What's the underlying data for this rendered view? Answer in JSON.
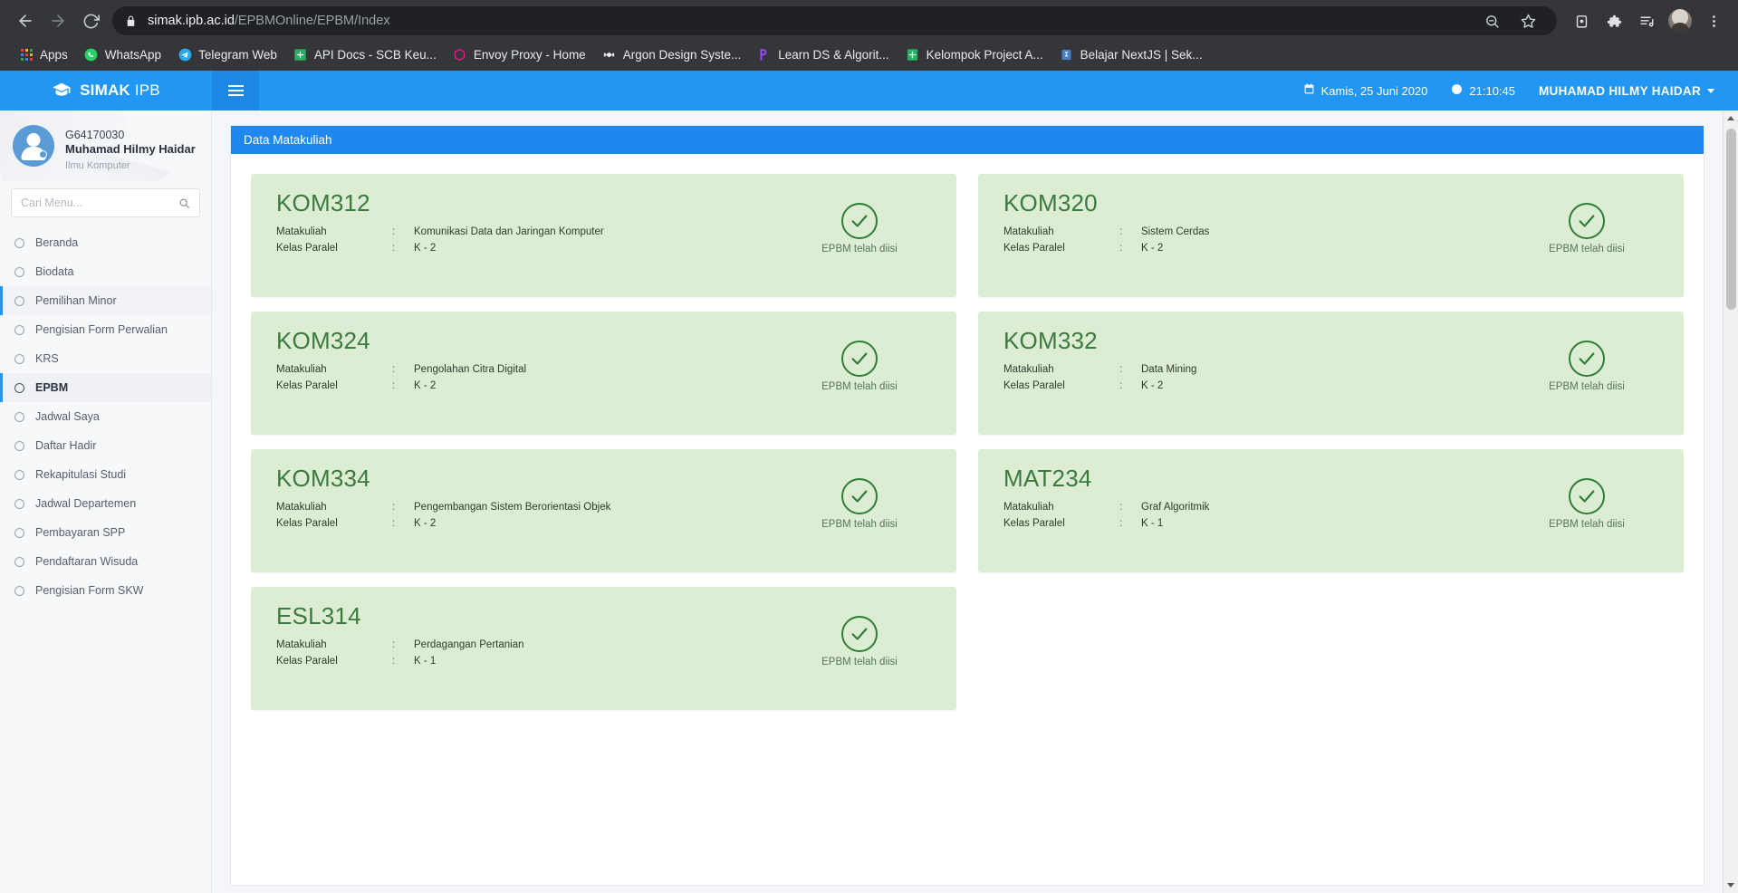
{
  "browser": {
    "url_host": "simak.ipb.ac.id",
    "url_path": "/EPBMOnline/EPBM/Index",
    "back_icon": "back-arrow-icon",
    "forward_icon": "forward-arrow-icon",
    "reload_icon": "reload-icon",
    "lock_icon": "lock-icon",
    "bookmarks": [
      {
        "label": "Apps",
        "icon": "apps-grid-icon"
      },
      {
        "label": "WhatsApp",
        "icon": "whatsapp-icon",
        "color": "#25D366"
      },
      {
        "label": "Telegram Web",
        "icon": "telegram-icon",
        "color": "#2AABEE"
      },
      {
        "label": "API Docs - SCB Keu...",
        "icon": "postman-docs-icon",
        "color": "#27ae60"
      },
      {
        "label": "Envoy Proxy - Home",
        "icon": "envoy-icon",
        "color": "#e91e8c"
      },
      {
        "label": "Argon Design Syste...",
        "icon": "argon-icon",
        "color": "#f1f3f4"
      },
      {
        "label": "Learn DS & Algorit...",
        "icon": "learn-icon",
        "color": "#9b4dff"
      },
      {
        "label": "Kelompok Project A...",
        "icon": "sheets-icon",
        "color": "#27ae60"
      },
      {
        "label": "Belajar NextJS | Sek...",
        "icon": "nextjs-icon",
        "color": "#4a7fc1"
      }
    ],
    "toolbar_icons": [
      "zoom-out-icon",
      "bookmark-star-icon",
      "screenshot-icon",
      "extensions-puzzle-icon",
      "reading-list-icon",
      "profile-avatar-icon",
      "chrome-menu-icon"
    ]
  },
  "app": {
    "brand_bold": "SIMAK",
    "brand_light": "IPB",
    "brand_icon": "graduation-cap-icon",
    "menu_toggle_icon": "hamburger-icon",
    "date": "Kamis, 25 Juni 2020",
    "date_icon": "calendar-icon",
    "time": "21:10:45",
    "time_icon": "clock-icon",
    "user": "MUHAMAD HILMY HAIDAR"
  },
  "sidebar": {
    "profile": {
      "nim": "G64170030",
      "name": "Muhamad Hilmy Haidar",
      "department": "Ilmu Komputer",
      "avatar_icon": "user-avatar-icon"
    },
    "search": {
      "placeholder": "Cari Menu...",
      "value": "",
      "icon": "search-icon"
    },
    "items": [
      {
        "label": "Beranda",
        "state": "normal"
      },
      {
        "label": "Biodata",
        "state": "normal"
      },
      {
        "label": "Pemilihan Minor",
        "state": "hovered"
      },
      {
        "label": "Pengisian Form Perwalian",
        "state": "normal"
      },
      {
        "label": "KRS",
        "state": "normal"
      },
      {
        "label": "EPBM",
        "state": "active"
      },
      {
        "label": "Jadwal Saya",
        "state": "normal"
      },
      {
        "label": "Daftar Hadir",
        "state": "normal"
      },
      {
        "label": "Rekapitulasi Studi",
        "state": "normal"
      },
      {
        "label": "Jadwal Departemen",
        "state": "normal"
      },
      {
        "label": "Pembayaran SPP",
        "state": "normal"
      },
      {
        "label": "Pendaftaran Wisuda",
        "state": "normal"
      },
      {
        "label": "Pengisian Form SKW",
        "state": "normal"
      }
    ]
  },
  "main": {
    "panel_title": "Data Matakuliah",
    "labels": {
      "course": "Matakuliah",
      "class": "Kelas Paralel",
      "separator": ":"
    },
    "status_text": "EPBM telah diisi",
    "status_icon": "check-circle-icon",
    "courses": [
      {
        "code": "KOM312",
        "course": "Komunikasi Data dan Jaringan Komputer",
        "class": "K - 2"
      },
      {
        "code": "KOM320",
        "course": "Sistem Cerdas",
        "class": "K - 2"
      },
      {
        "code": "KOM324",
        "course": "Pengolahan Citra Digital",
        "class": "K - 2"
      },
      {
        "code": "KOM332",
        "course": "Data Mining",
        "class": "K - 2"
      },
      {
        "code": "KOM334",
        "course": "Pengembangan Sistem Berorientasi Objek",
        "class": "K - 2"
      },
      {
        "code": "MAT234",
        "course": "Graf Algoritmik",
        "class": "K - 1"
      },
      {
        "code": "ESL314",
        "course": "Perdagangan Pertanian",
        "class": "K - 1"
      }
    ]
  },
  "colors": {
    "brand_blue": "#2196f3",
    "panel_header_blue": "#1e88f0",
    "card_green_bg": "#dcedd3",
    "card_green_text": "#3b7a3f",
    "status_green": "#2f7d39"
  }
}
